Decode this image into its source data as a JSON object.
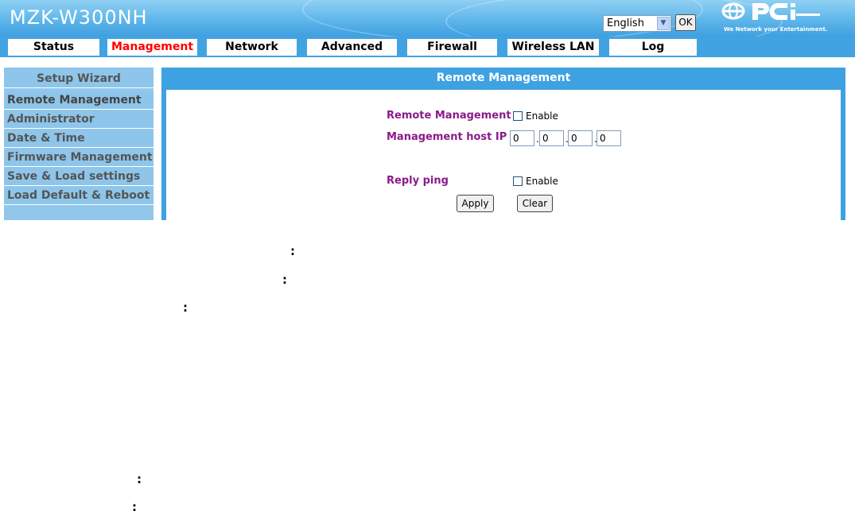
{
  "header": {
    "model_name": "MZK-W300NH",
    "language_select": {
      "selected": "English"
    },
    "ok_label": "OK",
    "brand": {
      "logo_text": "PCi",
      "tagline": "We Network your Entertainment."
    },
    "colors": {
      "header_blue": "#5fb6ea",
      "accent_red": "#ff0000",
      "label_purple": "#8b1a8b"
    }
  },
  "tabs": [
    {
      "label": "Status"
    },
    {
      "label": "Management",
      "active": true
    },
    {
      "label": "Network"
    },
    {
      "label": "Advanced"
    },
    {
      "label": "Firewall"
    },
    {
      "label": "Wireless LAN"
    },
    {
      "label": "Log"
    }
  ],
  "sidebar": {
    "heading": "Setup Wizard",
    "items": [
      {
        "label": "Remote Management"
      },
      {
        "label": "Administrator"
      },
      {
        "label": "Date & Time"
      },
      {
        "label": "Firmware Management"
      },
      {
        "label": "Save & Load settings"
      },
      {
        "label": "Load Default & Reboot"
      }
    ]
  },
  "panel": {
    "title": "Remote Management",
    "remote_management": {
      "label": "Remote Management",
      "checkbox_text": "Enable",
      "checked": false
    },
    "host_ip": {
      "label": "Management host IP",
      "octets": [
        "0",
        "0",
        "0",
        "0"
      ]
    },
    "reply_ping": {
      "label": "Reply ping",
      "checkbox_text": "Enable",
      "checked": false
    },
    "apply_label": "Apply",
    "clear_label": "Clear"
  },
  "stray_marks": [
    ":",
    ":",
    ":",
    ":",
    ":"
  ]
}
